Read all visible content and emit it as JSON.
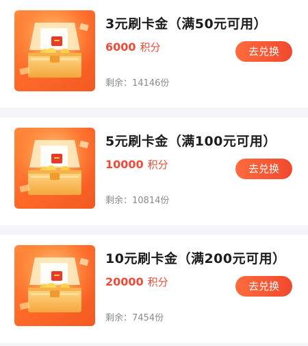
{
  "items": [
    {
      "title": "3元刷卡金（满50元可用）",
      "points": "6000",
      "points_unit": "积分",
      "stock_label": "剩余：",
      "stock_value": "14146份",
      "button": "去兑换"
    },
    {
      "title": "5元刷卡金（满100元可用）",
      "points": "10000",
      "points_unit": "积分",
      "stock_label": "剩余：",
      "stock_value": "10814份",
      "button": "去兑换"
    },
    {
      "title": "10元刷卡金（满200元可用）",
      "points": "20000",
      "points_unit": "积分",
      "stock_label": "剩余：",
      "stock_value": "7454份",
      "button": "去兑换"
    }
  ],
  "colors": {
    "accent": "#ef4a37",
    "button_start": "#ff6b3d",
    "button_end": "#f0492e",
    "title": "#1c1c1c",
    "muted": "#8a8a8a",
    "thumb_bg": "#ff6a2a"
  },
  "icons": {
    "thumbnail": "treasure-chest-image"
  }
}
